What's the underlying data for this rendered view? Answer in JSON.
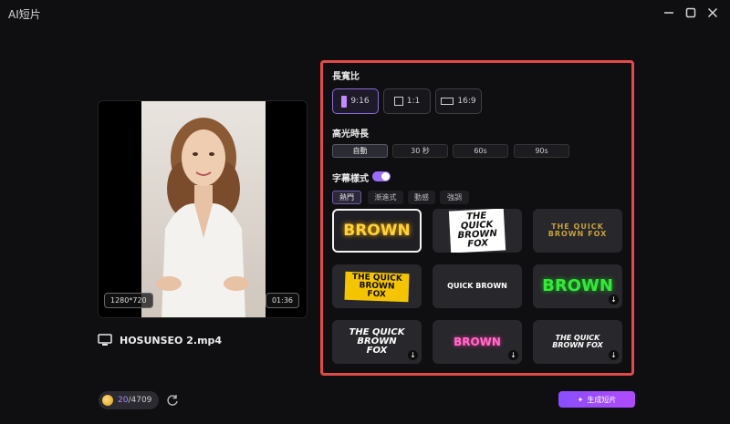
{
  "window": {
    "title": "AI短片"
  },
  "preview": {
    "resolution": "1280*720",
    "duration": "01:36",
    "file_name": "HOSUNSEO 2.mp4"
  },
  "credits": {
    "used": "20",
    "total": "/4709"
  },
  "aspect": {
    "title": "長寬比",
    "options": [
      {
        "label": "9:16",
        "shape": "vertical",
        "active": true
      },
      {
        "label": "1:1",
        "shape": "square",
        "active": false
      },
      {
        "label": "16:9",
        "shape": "horizontal",
        "active": false
      }
    ]
  },
  "highlight": {
    "title": "高光時長",
    "options": [
      "自動",
      "30 秒",
      "60s",
      "90s"
    ]
  },
  "subtitle": {
    "title": "字幕樣式",
    "enabled": true,
    "tabs": [
      "熱門",
      "漸進式",
      "動感",
      "強調"
    ],
    "styles": [
      {
        "text": "BROWN"
      },
      {
        "text": "THE QUICK BROWN FOX"
      },
      {
        "text": "THE QUICK BROWN FOX"
      },
      {
        "text": "THE QUICK BROWN FOX"
      },
      {
        "text": "QUICK BROWN"
      },
      {
        "text": "BROWN"
      },
      {
        "text": "THE QUICK BROWN FOX"
      },
      {
        "text": "BROWN"
      },
      {
        "text": "THE QUICK BROWN FOX"
      }
    ]
  },
  "generate": {
    "label": "生成短片"
  },
  "colors": {
    "accent": "#9a6bff",
    "highlight_border": "#e24a4a"
  }
}
